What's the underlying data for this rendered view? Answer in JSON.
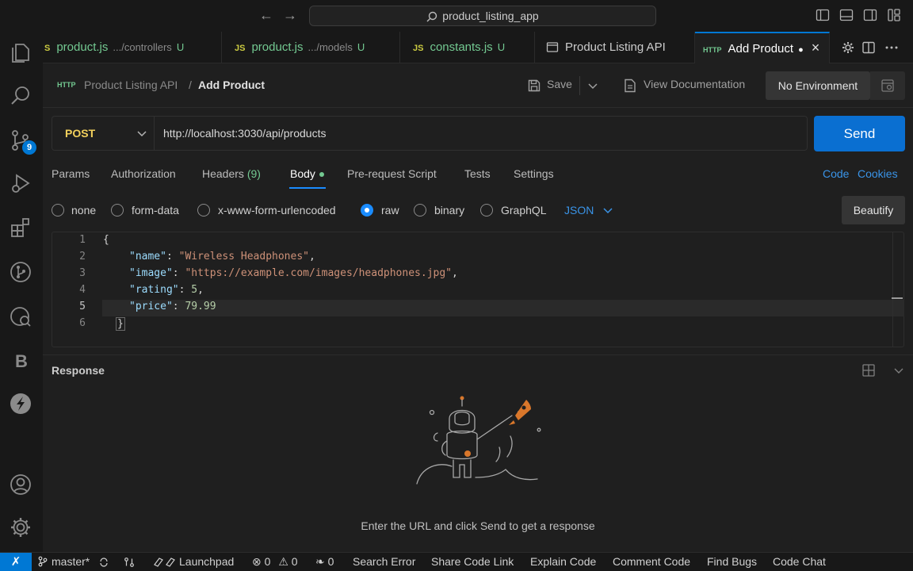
{
  "titlebar": {
    "search_text": "product_listing_app"
  },
  "activity": {
    "source_control_badge": "9"
  },
  "tabs": [
    {
      "prefix": "S",
      "name": "product.js",
      "path": ".../controllers",
      "status": "U"
    },
    {
      "prefix": "JS",
      "name": "product.js",
      "path": ".../models",
      "status": "U"
    },
    {
      "prefix": "JS",
      "name": "constants.js",
      "status": "U"
    },
    {
      "name": "Product Listing API"
    },
    {
      "name": "Add Product",
      "modified": "●"
    }
  ],
  "breadcrumb": {
    "collection": "Product Listing API",
    "separator": "/",
    "request": "Add Product"
  },
  "toolbar": {
    "save_label": "Save",
    "docs_label": "View Documentation",
    "environment": "No Environment"
  },
  "request": {
    "method": "POST",
    "url": "http://localhost:3030/api/products",
    "send_label": "Send"
  },
  "request_tabs": {
    "params": "Params",
    "authorization": "Authorization",
    "headers": "Headers",
    "headers_count": "(9)",
    "body": "Body",
    "prerequest": "Pre-request Script",
    "tests": "Tests",
    "settings": "Settings",
    "code": "Code",
    "cookies": "Cookies"
  },
  "body_types": {
    "none": "none",
    "form_data": "form-data",
    "urlencoded": "x-www-form-urlencoded",
    "raw": "raw",
    "binary": "binary",
    "graphql": "GraphQL",
    "format": "JSON",
    "beautify": "Beautify",
    "selected": "raw"
  },
  "editor": {
    "line_numbers": [
      "1",
      "2",
      "3",
      "4",
      "5",
      "6"
    ],
    "open_brace": "{",
    "close_brace": "}",
    "fields": [
      {
        "key": "\"name\"",
        "value": "\"Wireless Headphones\"",
        "comma": ","
      },
      {
        "key": "\"image\"",
        "value": "\"https://example.com/images/headphones.jpg\"",
        "comma": ","
      },
      {
        "key": "\"rating\"",
        "value": "5",
        "comma": ","
      },
      {
        "key": "\"price\"",
        "value": "79.99",
        "comma": ""
      }
    ],
    "colon": ": "
  },
  "response": {
    "title": "Response",
    "empty_hint": "Enter the URL and click Send to get a response"
  },
  "statusbar": {
    "branch": "master*",
    "launchpad": "Launchpad",
    "errors": "0",
    "warnings": "0",
    "ports": "0",
    "items": [
      "Search Error",
      "Share Code Link",
      "Explain Code",
      "Comment Code",
      "Find Bugs",
      "Code Chat"
    ]
  }
}
